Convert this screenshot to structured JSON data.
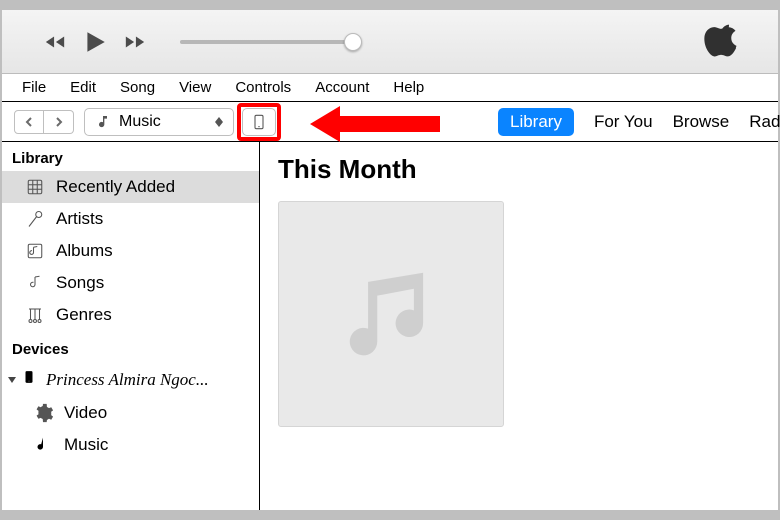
{
  "menu": {
    "file": "File",
    "edit": "Edit",
    "song": "Song",
    "view": "View",
    "controls": "Controls",
    "account": "Account",
    "help": "Help"
  },
  "dropdown": {
    "label": "Music",
    "icon": "music-note-icon"
  },
  "tabs": {
    "library": "Library",
    "for_you": "For You",
    "browse": "Browse",
    "radio": "Rad"
  },
  "sidebar": {
    "library_heading": "Library",
    "library_items": [
      {
        "icon": "grid-icon",
        "label": "Recently Added",
        "selected": true
      },
      {
        "icon": "mic-icon",
        "label": "Artists",
        "selected": false
      },
      {
        "icon": "album-icon",
        "label": "Albums",
        "selected": false
      },
      {
        "icon": "music-note-icon",
        "label": "Songs",
        "selected": false
      },
      {
        "icon": "genre-icon",
        "label": "Genres",
        "selected": false
      }
    ],
    "devices_heading": "Devices",
    "device": {
      "icon": "phone-icon",
      "name": "Princess Almira Ngoc...",
      "subs": [
        {
          "icon": "gear-icon",
          "label": "Video"
        },
        {
          "icon": "music-note-icon",
          "label": "Music"
        }
      ]
    }
  },
  "main": {
    "section_title": "This Month",
    "placeholder_icon": "music-note-icon"
  },
  "colors": {
    "accent": "#0a84ff",
    "callout": "#ff0000"
  }
}
